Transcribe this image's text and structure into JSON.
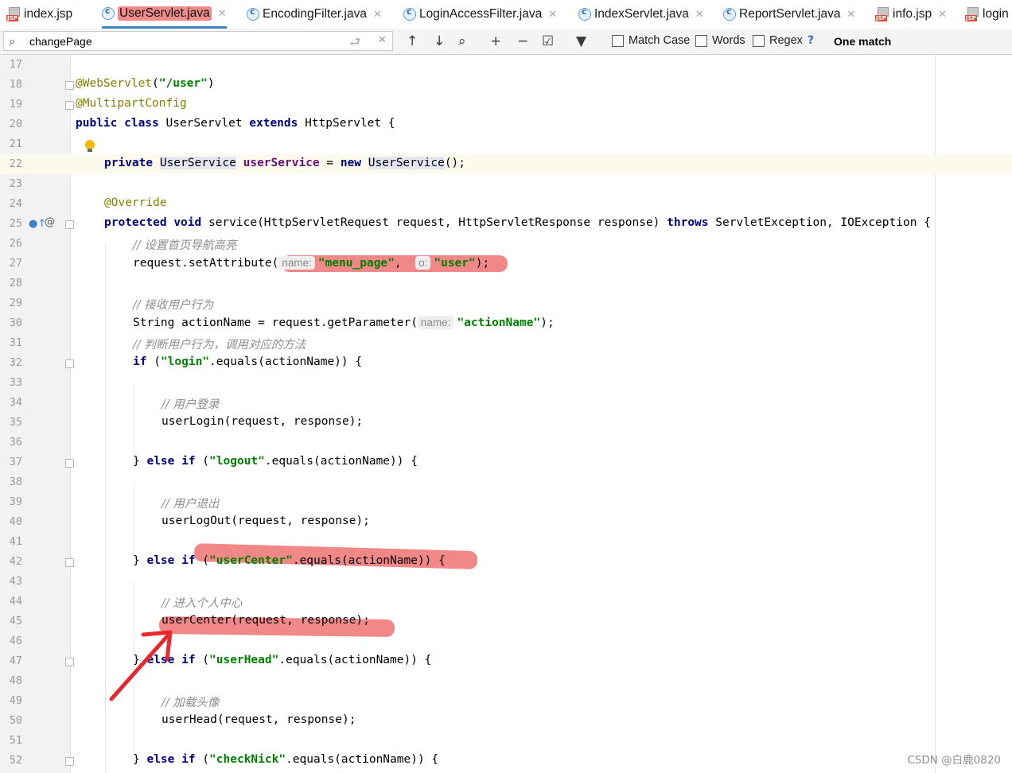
{
  "tabs": [
    {
      "label": "index.jsp",
      "type": "jsp"
    },
    {
      "label": "UserServlet.java",
      "type": "class",
      "active": true
    },
    {
      "label": "EncodingFilter.java",
      "type": "class"
    },
    {
      "label": "LoginAccessFilter.java",
      "type": "class"
    },
    {
      "label": "IndexServlet.java",
      "type": "class"
    },
    {
      "label": "ReportServlet.java",
      "type": "class"
    },
    {
      "label": "info.jsp",
      "type": "jsp"
    },
    {
      "label": "login",
      "type": "jsp"
    }
  ],
  "search": {
    "query": "changePage",
    "options": {
      "match_case": "Match Case",
      "words": "Words",
      "regex": "Regex"
    },
    "help": "?",
    "result": "One match"
  },
  "line_numbers": [
    "17",
    "18",
    "19",
    "20",
    "21",
    "22",
    "23",
    "24",
    "25",
    "26",
    "27",
    "28",
    "29",
    "30",
    "31",
    "32",
    "33",
    "34",
    "35",
    "36",
    "37",
    "38",
    "39",
    "40",
    "41",
    "42",
    "43",
    "44",
    "45",
    "46",
    "47",
    "48",
    "49",
    "50",
    "51",
    "52"
  ],
  "code": {
    "l18_annotation": "@WebServlet",
    "l18_string": "\"/user\"",
    "l19_annotation": "@MultipartConfig",
    "l20_kw1": "public class",
    "l20_name": " UserServlet ",
    "l20_kw2": "extends",
    "l20_super": " HttpServlet {",
    "l22_kw": "private",
    "l22_type": "UserService",
    "l22_field": "userService",
    "l22_eq": " = ",
    "l22_new": "new",
    "l22_ctor": "UserService",
    "l22_tail": "();",
    "l24_annotation": "@Override",
    "l25_kw1": "protected",
    "l25_kw2": "void",
    "l25_sig": " service(HttpServletRequest request, HttpServletResponse response) ",
    "l25_kw3": "throws",
    "l25_tail": " ServletException, IOException {",
    "l26_comment": "// 设置首页导航高亮",
    "l27_pre": "request.setAttribute(",
    "l27_hint1": "name:",
    "l27_str1": "\"menu_page\"",
    "l27_comma": ",  ",
    "l27_hint2": "o:",
    "l27_str2": "\"user\"",
    "l27_tail": ");",
    "l29_comment": "// 接收用户行为",
    "l30_pre": "String actionName = request.getParameter(",
    "l30_hint": "name:",
    "l30_str": "\"actionName\"",
    "l30_tail": ");",
    "l31_comment": "// 判断用户行为，调用对应的方法",
    "l32_kw": "if",
    "l32_open": " (",
    "l32_str": "\"login\"",
    "l32_tail": ".equals(actionName)) {",
    "l34_comment": "// 用户登录",
    "l35_code": "userLogin(request, response);",
    "l37_pre": "} ",
    "l37_kw": "else if",
    "l37_open": " (",
    "l37_str": "\"logout\"",
    "l37_tail": ".equals(actionName)) {",
    "l39_comment": "// 用户退出",
    "l40_code": "userLogOut(request, response);",
    "l42_pre": "} ",
    "l42_kw": "else if",
    "l42_open": " (",
    "l42_str": "\"userCenter\"",
    "l42_tail": ".equals(actionName)) {",
    "l44_comment": "// 进入个人中心",
    "l45_code": "userCenter(request, response);",
    "l47_pre": "} ",
    "l47_kw": "else if",
    "l47_open": " (",
    "l47_str": "\"userHead\"",
    "l47_tail": ".equals(actionName)) {",
    "l49_comment": "// 加载头像",
    "l50_code": "userHead(request, response);",
    "l52_pre": "} ",
    "l52_kw": "else if",
    "l52_open": " (",
    "l52_str": "\"checkNick\"",
    "l52_tail": ".equals(actionName)) {"
  },
  "watermark": "CSDN @白鹿0820",
  "colors": {
    "marker": "#ec6060",
    "arrow": "#e8282c",
    "tab_underline": "#4083c9",
    "current_line": "#fcfaed"
  }
}
